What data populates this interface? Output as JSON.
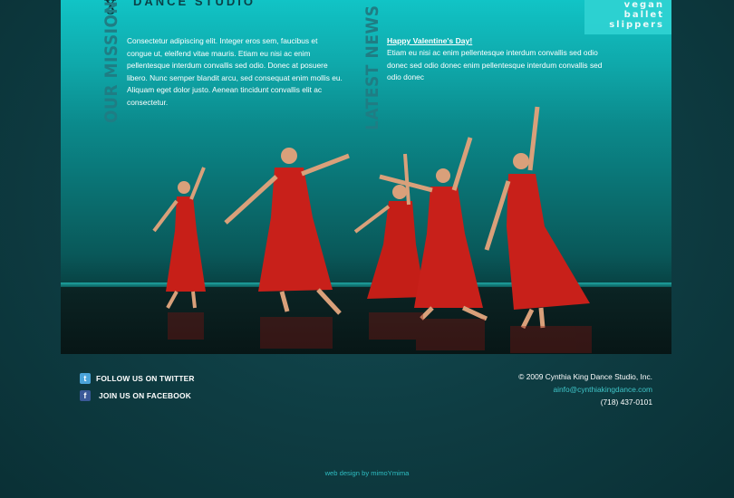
{
  "brand": {
    "logo_text": "DANCE STUDIO",
    "badge_lines": [
      "vegan",
      "ballet",
      "slippers"
    ]
  },
  "mission": {
    "heading": "OUR MISSION",
    "text": "Consectetur adipiscing elit. Integer eros sem, faucibus et congue ut, eleifend vitae mauris. Etiam eu nisi ac enim pellentesque interdum convallis sed odio. Donec at posuere libero. Nunc semper blandit arcu, sed consequat enim mollis eu. Aliquam eget dolor justo. Aenean tincidunt convallis elit ac consectetur."
  },
  "news": {
    "heading": "LATEST NEWS",
    "title": "Happy Valentine's Day!",
    "text": "Etiam eu nisi ac enim pellentesque interdum convallis sed odio donec sed odio donec enim pellentesque interdum convallis sed odio donec"
  },
  "social": {
    "twitter_label": "FOLLOW US ON TWITTER",
    "facebook_label": "JOIN US ON FACEBOOK"
  },
  "contact": {
    "copyright": "© 2009 Cynthia King Dance Studio, Inc.",
    "email": "ainfo@cynthiakingdance.com",
    "phone": "(718) 437-0101"
  },
  "credit": "web design by mimoYmima",
  "colors": {
    "page_bg": "#0d3a40",
    "accent": "#2fd3d3",
    "heading": "#1f7d84",
    "dress": "#c8201a"
  }
}
